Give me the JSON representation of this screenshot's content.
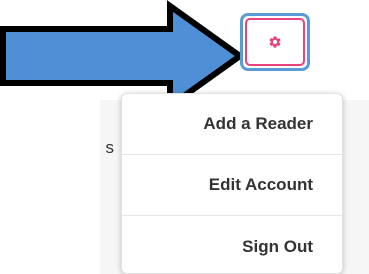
{
  "background": {
    "partial_text": "s"
  },
  "arrow": {
    "fill_color": "#4f8fd6",
    "stroke_color": "#000000"
  },
  "settings_button": {
    "icon": "gear-icon",
    "icon_color": "#e8437e",
    "highlight_color": "#5b9bd5"
  },
  "dropdown_menu": {
    "items": [
      {
        "label": "Add a Reader"
      },
      {
        "label": "Edit Account"
      },
      {
        "label": "Sign Out"
      }
    ]
  }
}
